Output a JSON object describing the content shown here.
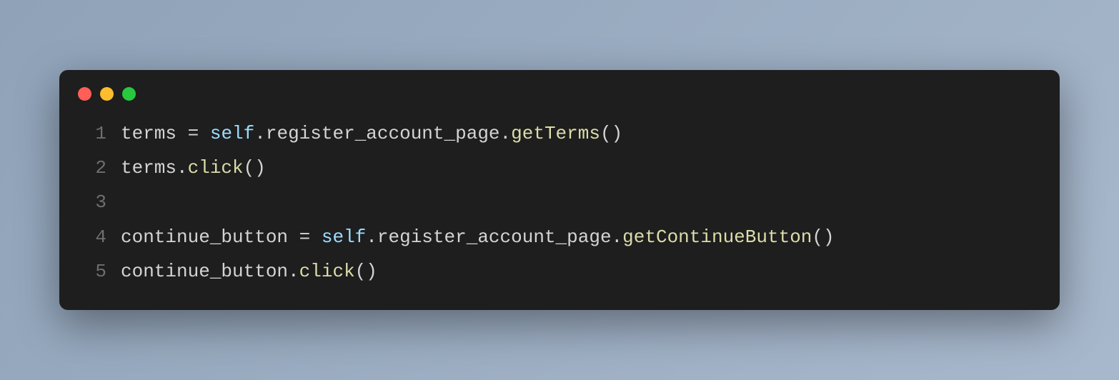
{
  "window": {
    "traffic_lights": [
      "close",
      "minimize",
      "zoom"
    ]
  },
  "code": {
    "lines": [
      {
        "num": "1",
        "tokens": [
          {
            "cls": "t-var",
            "text": "terms "
          },
          {
            "cls": "t-op",
            "text": "="
          },
          {
            "cls": "t-var",
            "text": " "
          },
          {
            "cls": "t-self",
            "text": "self"
          },
          {
            "cls": "t-punct",
            "text": "."
          },
          {
            "cls": "t-prop",
            "text": "register_account_page"
          },
          {
            "cls": "t-punct",
            "text": "."
          },
          {
            "cls": "t-method",
            "text": "getTerms"
          },
          {
            "cls": "t-paren",
            "text": "()"
          }
        ]
      },
      {
        "num": "2",
        "tokens": [
          {
            "cls": "t-var",
            "text": "terms"
          },
          {
            "cls": "t-punct",
            "text": "."
          },
          {
            "cls": "t-method",
            "text": "click"
          },
          {
            "cls": "t-paren",
            "text": "()"
          }
        ]
      },
      {
        "num": "3",
        "tokens": []
      },
      {
        "num": "4",
        "tokens": [
          {
            "cls": "t-var",
            "text": "continue_button "
          },
          {
            "cls": "t-op",
            "text": "="
          },
          {
            "cls": "t-var",
            "text": " "
          },
          {
            "cls": "t-self",
            "text": "self"
          },
          {
            "cls": "t-punct",
            "text": "."
          },
          {
            "cls": "t-prop",
            "text": "register_account_page"
          },
          {
            "cls": "t-punct",
            "text": "."
          },
          {
            "cls": "t-method",
            "text": "getContinueButton"
          },
          {
            "cls": "t-paren",
            "text": "()"
          }
        ]
      },
      {
        "num": "5",
        "tokens": [
          {
            "cls": "t-var",
            "text": "continue_button"
          },
          {
            "cls": "t-punct",
            "text": "."
          },
          {
            "cls": "t-method",
            "text": "click"
          },
          {
            "cls": "t-paren",
            "text": "()"
          }
        ]
      }
    ]
  }
}
